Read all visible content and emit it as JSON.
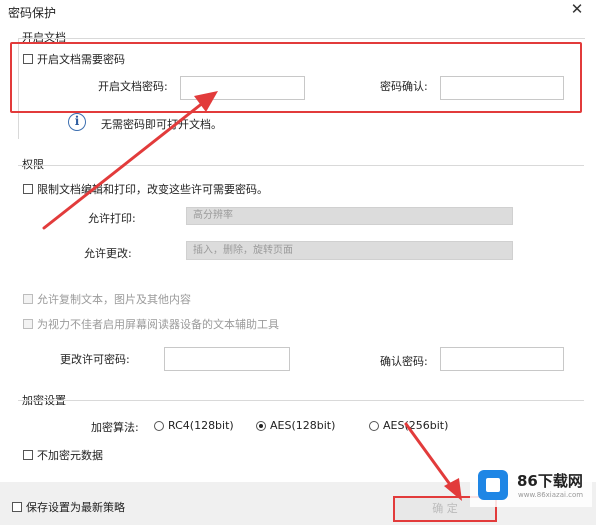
{
  "window": {
    "title": "密码保护"
  },
  "open_section": {
    "heading": "开启文档",
    "require_checkbox_label": "开启文档需要密码",
    "password_label": "开启文档密码:",
    "confirm_label": "密码确认:",
    "info_text": "无需密码即可打开文档。"
  },
  "permissions_section": {
    "heading": "权限",
    "restrict_checkbox_label": "限制文档编辑和打印，改变这些许可需要密码。",
    "print_label": "允许打印:",
    "print_value": "高分辨率",
    "change_label": "允许更改:",
    "change_value": "插入，删除，旋转页面",
    "copy_checkbox_label": "允许复制文本，图片及其他内容",
    "accessibility_checkbox_label": "为视力不佳者启用屏幕阅读器设备的文本辅助工具",
    "change_password_label": "更改许可密码:",
    "confirm_password_label": "确认密码:"
  },
  "encryption_section": {
    "heading": "加密设置",
    "algorithm_label": "加密算法:",
    "options": [
      "RC4(128bit)",
      "AES(128bit)",
      "AES(256bit)"
    ],
    "selected": "AES(128bit)",
    "no_metadata_label": "不加密元数据"
  },
  "footer": {
    "save_policy_label": "保存设置为最新策略",
    "ok_button_label": "确 定"
  },
  "watermark": {
    "brand": "86下载网",
    "url": "www.86xiazai.com"
  },
  "colors": {
    "annotation": "#e23b3b",
    "logo_blue": "#1f86e5"
  }
}
